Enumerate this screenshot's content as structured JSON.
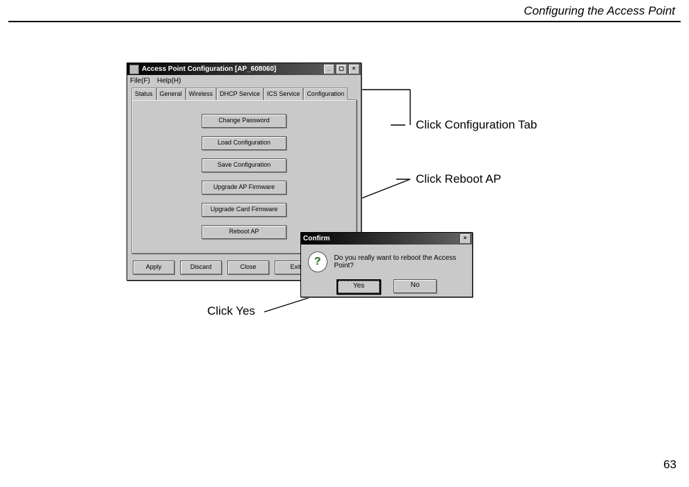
{
  "header": {
    "title": "Configuring the Access Point"
  },
  "page_number": "63",
  "window": {
    "title": "Access Point Configuration [AP_608060]",
    "menu": {
      "file": "File(F)",
      "help": "Help(H)"
    },
    "tabs": [
      "Status",
      "General",
      "Wireless",
      "DHCP Service",
      "ICS Service",
      "Configuration"
    ],
    "actions": {
      "change_password": "Change Password",
      "load_config": "Load Configuration",
      "save_config": "Save Configuration",
      "upgrade_ap": "Upgrade AP Firmware",
      "upgrade_card": "Upgrade Card Firmware",
      "reboot": "Reboot AP"
    },
    "bottom": {
      "apply": "Apply",
      "discard": "Discard",
      "close": "Close",
      "exit": "Exit"
    }
  },
  "confirm": {
    "title": "Confirm",
    "message": "Do you really want to reboot the Access Point?",
    "yes": "Yes",
    "no": "No"
  },
  "callouts": {
    "config_tab": "Click Configuration Tab",
    "reboot": "Click Reboot AP",
    "yes": "Click Yes"
  }
}
